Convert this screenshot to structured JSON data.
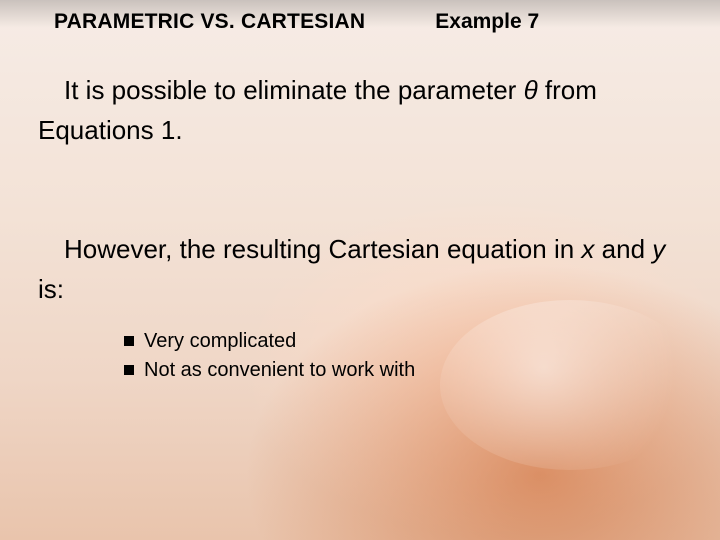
{
  "header": {
    "topic": "PARAMETRIC VS. CARTESIAN",
    "example": "Example 7"
  },
  "paragraph1": {
    "pre": "It is possible to eliminate the parameter ",
    "theta": "θ",
    "post": " from Equations 1."
  },
  "paragraph2": {
    "pre": "However, the resulting Cartesian equation in ",
    "x": "x",
    "mid": " and ",
    "y": "y",
    "post": " is:"
  },
  "bullets": [
    "Very complicated",
    "Not as convenient to work with"
  ]
}
